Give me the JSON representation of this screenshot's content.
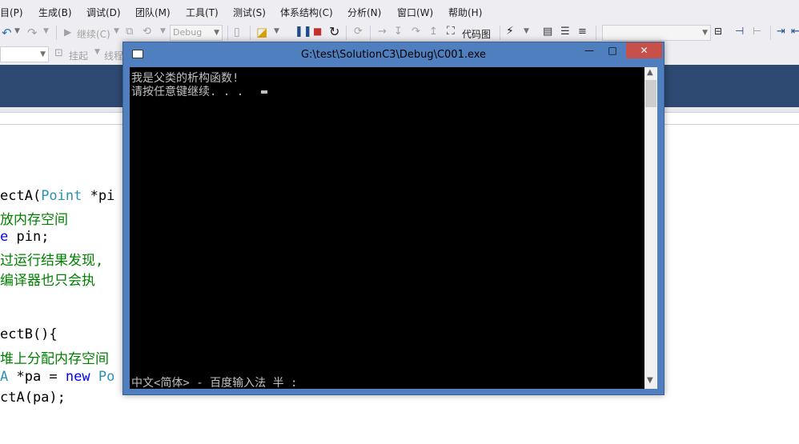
{
  "menu": {
    "items": [
      "目(P)",
      "生成(B)",
      "调试(D)",
      "团队(M)",
      "工具(T)",
      "测试(S)",
      "体系结构(C)",
      "分析(N)",
      "窗口(W)",
      "帮助(H)"
    ]
  },
  "toolbar": {
    "continue_label": "继续(C)",
    "config_value": "Debug",
    "codemap_label": "代码图",
    "suspend_label": "挂起",
    "thread_label": "线程"
  },
  "console": {
    "title": "G:\\test\\SolutionC3\\Debug\\C001.exe",
    "lines": [
      "我是父类的析构函数!",
      "请按任意键继续. . . "
    ],
    "ime_status": "中文<简体> - 百度输入法 半 :",
    "minimize": "—",
    "maximize": "□",
    "close": "✕"
  },
  "code": {
    "lines": [
      {
        "parts": [
          {
            "t": "ectA(",
            "c": "#000000"
          },
          {
            "t": "Point",
            "c": "#2b91af"
          },
          {
            "t": " *pi",
            "c": "#000000"
          }
        ]
      },
      {
        "parts": [
          {
            "t": "放内存空间",
            "c": "#008000"
          }
        ]
      },
      {
        "parts": [
          {
            "t": "e",
            "c": "#0000ff"
          },
          {
            "t": " pin;",
            "c": "#000000"
          }
        ]
      },
      {
        "parts": [
          {
            "t": "过运行结果发现,",
            "c": "#008000"
          }
        ]
      },
      {
        "parts": [
          {
            "t": "编译器也只会执",
            "c": "#008000"
          }
        ]
      },
      {
        "parts": [
          {
            "t": "",
            "c": "#000000"
          }
        ]
      },
      {
        "parts": [
          {
            "t": "ectB(){",
            "c": "#000000"
          }
        ]
      },
      {
        "parts": [
          {
            "t": "堆上分配内存空间",
            "c": "#008000"
          }
        ]
      },
      {
        "parts": [
          {
            "t": "A",
            "c": "#2b91af"
          },
          {
            "t": " *pa = ",
            "c": "#000000"
          },
          {
            "t": "new",
            "c": "#0000ff"
          },
          {
            "t": " Po",
            "c": "#2b91af"
          }
        ]
      },
      {
        "parts": [
          {
            "t": "ctA(pa);",
            "c": "#000000"
          }
        ]
      }
    ]
  },
  "colors": {
    "banner": "#2d4871",
    "console_frame": "#4f7fbf",
    "close_button": "#c7504b"
  }
}
